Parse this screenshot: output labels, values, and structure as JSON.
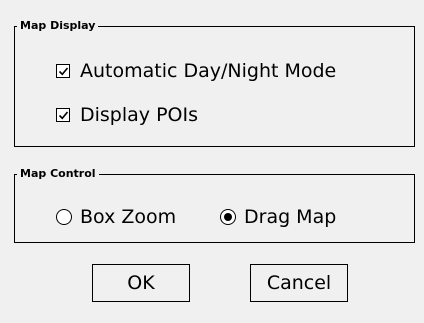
{
  "map_display": {
    "legend": "Map Display",
    "options": [
      {
        "label": "Automatic Day/Night Mode",
        "checked": true
      },
      {
        "label": "Display POIs",
        "checked": true
      }
    ]
  },
  "map_control": {
    "legend": "Map Control",
    "options": [
      {
        "label": "Box Zoom",
        "selected": false
      },
      {
        "label": "Drag Map",
        "selected": true
      }
    ]
  },
  "buttons": {
    "ok_label": "OK",
    "cancel_label": "Cancel"
  },
  "icons": {
    "checkbox": "check-icon",
    "radio": "radio-dot-icon"
  },
  "colors": {
    "background": "#f0f0f0",
    "border": "#000000"
  }
}
